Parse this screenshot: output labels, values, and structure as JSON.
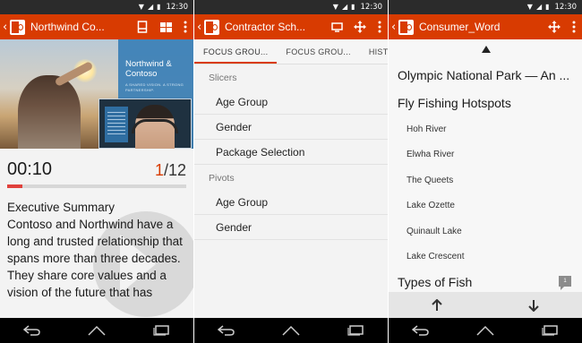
{
  "status": {
    "time": "12:30"
  },
  "colors": {
    "accent": "#d83b01",
    "progress": "#e0413c"
  },
  "screens": {
    "powerpoint": {
      "app_title": "Northwind Co...",
      "hero": {
        "panel_title": "Northwind & Contoso",
        "panel_subtitle": "A SHARED VISION. A STRONG PARTNERSHIP."
      },
      "timer": "00:10",
      "slide_current": "1",
      "slide_total": "/12",
      "progress_fraction": 0.083,
      "notes": [
        "Executive Summary",
        "Contoso and Northwind have a long and trusted relationship that spans more than three decades.",
        "They share core values and a vision of the future that has"
      ]
    },
    "excel": {
      "app_title": "Contractor Sch...",
      "tabs": [
        {
          "label": "FOCUS GROU..."
        },
        {
          "label": "FOCUS GROU..."
        },
        {
          "label": "HISTOR"
        }
      ],
      "slicers_header": "Slicers",
      "slicers": [
        "Age Group",
        "Gender",
        "Package Selection"
      ],
      "pivots_header": "Pivots",
      "pivots": [
        "Age Group",
        "Gender"
      ]
    },
    "word": {
      "app_title": "Consumer_Word",
      "doc_title": "Olympic National Park — An ...",
      "heading1": "Fly Fishing Hotspots",
      "items": [
        "Hoh River",
        "Elwha River",
        "The Queets",
        "Lake Ozette",
        "Quinault Lake",
        "Lake Crescent"
      ],
      "heading2": "Types of Fish",
      "comment_count": "1"
    }
  }
}
